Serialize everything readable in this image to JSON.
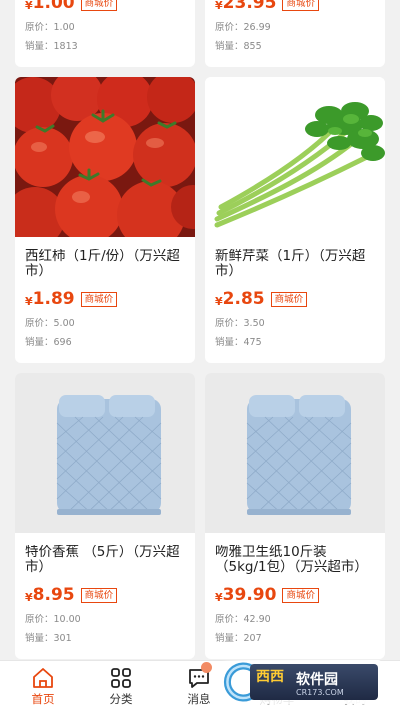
{
  "products": [
    {
      "name": "",
      "yen": "¥",
      "price": "1.00",
      "tag": "商城价",
      "original": "原价：1.00",
      "sales": "销量：1813"
    },
    {
      "name": "",
      "yen": "¥",
      "price": "23.95",
      "tag": "商城价",
      "original": "原价：26.99",
      "sales": "销量：855"
    },
    {
      "name": "西红柿（1斤/份）（万兴超市）",
      "yen": "¥",
      "price": "1.89",
      "tag": "商城价",
      "original": "原价：5.00",
      "sales": "销量：696"
    },
    {
      "name": "新鲜芹菜（1斤）（万兴超市）",
      "yen": "¥",
      "price": "2.85",
      "tag": "商城价",
      "original": "原价：3.50",
      "sales": "销量：475"
    },
    {
      "name": "特价香蕉 （5斤）（万兴超市）",
      "yen": "¥",
      "price": "8.95",
      "tag": "商城价",
      "original": "原价：10.00",
      "sales": "销量：301"
    },
    {
      "name": "吻雅卫生纸10斤装（5kg/1包）（万兴超市）",
      "yen": "¥",
      "price": "39.90",
      "tag": "商城价",
      "original": "原价：42.90",
      "sales": "销量：207"
    }
  ],
  "tabbar": {
    "home": "首页",
    "category": "分类",
    "messages": "消息",
    "cart": "购物车",
    "mine": "我的"
  },
  "watermark": {
    "brand": "西西",
    "name": "软件园",
    "url": "CR173.COM"
  },
  "colors": {
    "accent": "#e8470f",
    "background": "#f1f1f1"
  }
}
